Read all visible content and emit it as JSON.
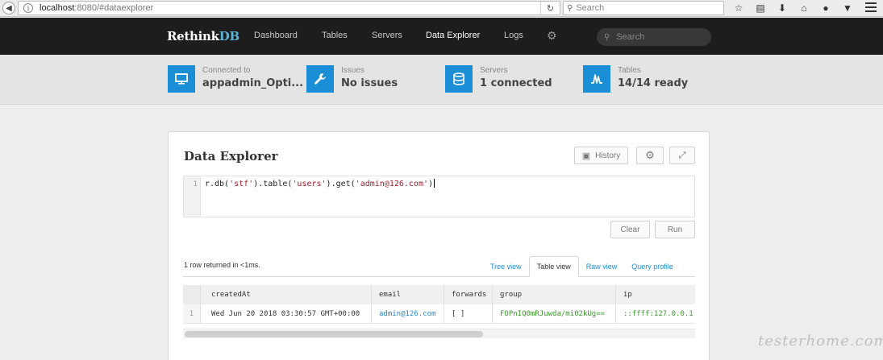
{
  "browser": {
    "url_host": "localhost",
    "url_rest": ":8080/#dataexplorer",
    "search_placeholder": "Search"
  },
  "navbar": {
    "brand_main": "Rethink",
    "brand_accent": "DB",
    "links": [
      "Dashboard",
      "Tables",
      "Servers",
      "Data Explorer",
      "Logs"
    ],
    "active_link": "Data Explorer",
    "search_placeholder": "Search"
  },
  "status": [
    {
      "label": "Connected to",
      "value": "appadmin_Opti...",
      "icon": "monitor-icon"
    },
    {
      "label": "Issues",
      "value": "No issues",
      "icon": "wrench-icon"
    },
    {
      "label": "Servers",
      "value": "1 connected",
      "icon": "database-icon"
    },
    {
      "label": "Tables",
      "value": "14/14 ready",
      "icon": "activity-icon"
    }
  ],
  "explorer": {
    "title": "Data Explorer",
    "history_label": "History",
    "line_number": "1",
    "query_parts": [
      "r.db(",
      "'stf'",
      ").table(",
      "'users'",
      ").get(",
      "'admin@126.com'",
      ")"
    ],
    "clear_label": "Clear",
    "run_label": "Run",
    "result_summary": "1 row returned in <1ms.",
    "tabs": [
      "Tree view",
      "Table view",
      "Raw view",
      "Query profile"
    ],
    "active_tab": "Table view"
  },
  "table": {
    "columns": [
      "createdAt",
      "email",
      "forwards",
      "group",
      "ip"
    ],
    "rows": [
      {
        "index": "1",
        "createdAt": "Wed Jun 20 2018 03:30:57 GMT+00:00",
        "email": "admin@126.com",
        "forwards": "[ ]",
        "group": "FOPnIQ0mRJuwda/mi02kUg==",
        "ip": "::ffff:127.0.0.1"
      }
    ]
  },
  "watermark": "testerhome.com",
  "colors": {
    "accent": "#1a8ed6",
    "navbar_bg": "#1d1d1d",
    "string_green": "#3a9a2a",
    "code_string": "#a8192a"
  }
}
